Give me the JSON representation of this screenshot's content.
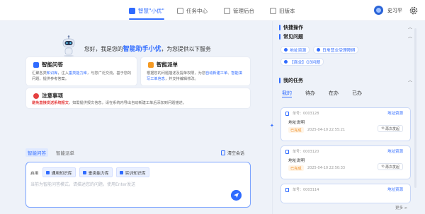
{
  "nav": {
    "items": [
      {
        "label": "智慧\"小优\"",
        "active": true,
        "icon": "chat-icon"
      },
      {
        "label": "任务中心",
        "active": false,
        "icon": "task-icon"
      },
      {
        "label": "管理后台",
        "active": false,
        "icon": "admin-icon"
      },
      {
        "label": "旧版本",
        "active": false,
        "icon": "monitor-icon"
      }
    ],
    "user": "史习平"
  },
  "welcome": {
    "prefix": "您好，我是您的",
    "name": "智能助手小优",
    "suffix": "，为您提供以下服务"
  },
  "cards": {
    "qa": {
      "title": "智能问答",
      "desc_a": "汇聚各类",
      "desc_b": "知识库",
      "desc_c": "，注入",
      "desc_d": "垂类能力库",
      "desc_e": "，与您广泛交流，基于您的问题，提供参考答案。"
    },
    "dispatch": {
      "title": "智能派单",
      "desc_a": "根据您的问题描述及提单权限，为您",
      "desc_b": "自动新建工单",
      "desc_c": "、",
      "desc_d": "智能填写工单信息",
      "desc_e": "，并支持编辑修改。"
    },
    "notice": {
      "title": "注意事项",
      "desc_a": "避免直接发送系统报文",
      "desc_b": "，如需提供报文信息，请在系统内导出自动新建工单后添加到问题描述。"
    }
  },
  "chat": {
    "tabs": [
      "智能问答",
      "智能派单"
    ],
    "clear": "清空会话",
    "kb_label": "启用",
    "kb_chips": [
      "通用知识库",
      "垂类能力库",
      "实训知识库"
    ],
    "placeholder": "当前为智能问答模式，请描述您的问题，使用Enter发送"
  },
  "panel": {
    "quick_ops": "快捷操作",
    "faq_title": "常见问题",
    "faq": [
      "地址资源",
      "日常营业受理障碍",
      "【商业】O3问题"
    ],
    "tasks_title": "我的任务",
    "task_tabs": [
      "我的",
      "待办",
      "在办",
      "已办"
    ],
    "tasks": [
      {
        "num": "单号：0003128",
        "link": "地址资源",
        "title": "地址说明",
        "status": "已完成",
        "time": "2025-04-10 22:55:21",
        "action": "再次发起"
      },
      {
        "num": "单号：0003120",
        "link": "地址资源",
        "title": "地址说明",
        "status": "已完成",
        "time": "2025-04-10 22:50:33",
        "action": "再次发起"
      },
      {
        "num": "单号：0003114",
        "link": "地址资源",
        "title": "",
        "status": "",
        "time": "",
        "action": ""
      }
    ],
    "more": "更多 >"
  },
  "colors": {
    "accent": "#2f6bff",
    "warning": "#f08a1c",
    "danger": "#e54040"
  }
}
